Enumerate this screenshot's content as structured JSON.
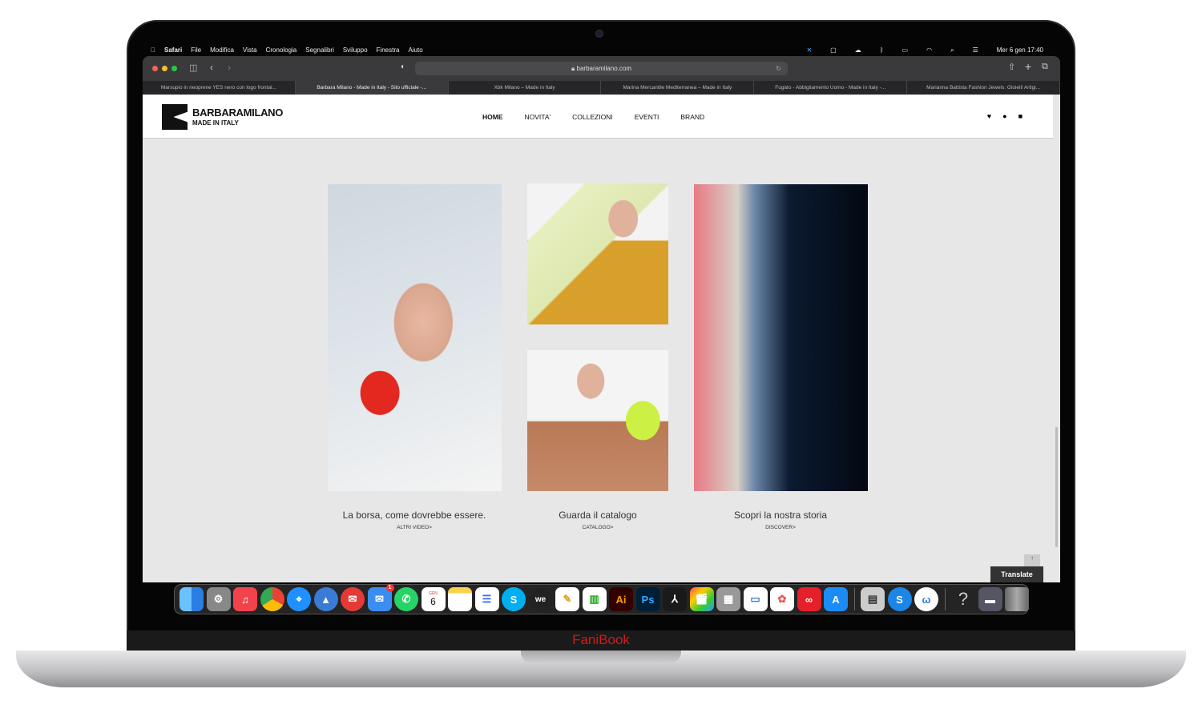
{
  "menubar": {
    "apple": "",
    "app": "Safari",
    "items": [
      "File",
      "Modifica",
      "Vista",
      "Cronologia",
      "Segnalibri",
      "Sviluppo",
      "Finestra",
      "Aiuto"
    ],
    "clock": "Mer 6 gen  17:40"
  },
  "browser": {
    "url": "barbaramilano.com",
    "tabs": [
      "Marsupio in neoprene YES nero con logo frontal...",
      "Barbara Milano - Made in Italy - Sito ufficiale -...",
      "Xbk Milano – Made in Italy",
      "Marina Mercantile Mediterranea – Made in Italy",
      "Fugàto - Abbigliamento Uomo - Made in Italy -...",
      "Marianna Battista Fashion Jewels: Gioielli Artigi..."
    ],
    "active_tab": 1
  },
  "site": {
    "logo_title": "BARBARAMILANO",
    "logo_subtitle": "MADE IN ITALY",
    "nav": [
      "HOME",
      "NOVITA'",
      "COLLEZIONI",
      "EVENTI",
      "BRAND"
    ],
    "cards": [
      {
        "caption": "La borsa, come dovrebbe essere.",
        "link": "ALTRI VIDEO>"
      },
      {
        "caption": "Guarda il catalogo",
        "link": "CATALOGO>"
      },
      {
        "caption": "Scopri la nostra storia",
        "link": "DISCOVER>"
      }
    ],
    "translate": "Translate",
    "top": "↑"
  },
  "dock": {
    "mail_badge": "1",
    "calendar_month": "GEN",
    "calendar_day": "6",
    "icons": [
      "finder",
      "system-preferences",
      "music",
      "chrome",
      "safari",
      "spark",
      "airmail",
      "mail",
      "whatsapp",
      "calendar",
      "notes",
      "reminders",
      "skype",
      "wetransfer",
      "pages",
      "numbers",
      "illustrator",
      "photoshop",
      "acrobat",
      "final-cut",
      "launchpad",
      "keynote",
      "photos",
      "creative-cloud",
      "app-store",
      "preview",
      "skype-2",
      "word-app",
      "help",
      "screenshot",
      "trash"
    ]
  },
  "laptop": {
    "brand": "FaniBook"
  }
}
